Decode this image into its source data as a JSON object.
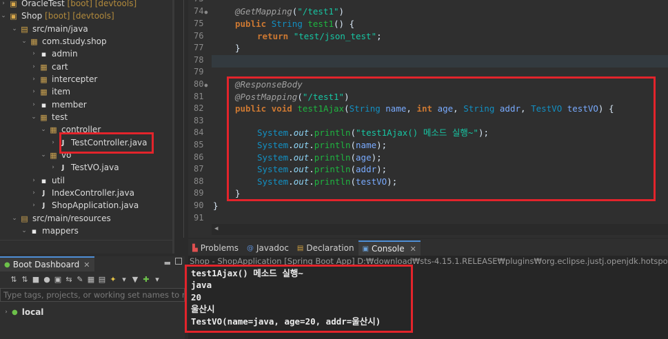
{
  "explorer": {
    "rows": [
      {
        "label": "OracleTest",
        "decor": "[boot] [devtools]"
      },
      {
        "label": "Shop",
        "decor": "[boot] [devtools]"
      },
      {
        "label": "src/main/java"
      },
      {
        "label": "com.study.shop"
      },
      {
        "label": "admin"
      },
      {
        "label": "cart"
      },
      {
        "label": "intercepter"
      },
      {
        "label": "item"
      },
      {
        "label": "member"
      },
      {
        "label": "test"
      },
      {
        "label": "controller"
      },
      {
        "label": "TestController.java"
      },
      {
        "label": "vo"
      },
      {
        "label": "TestVO.java"
      },
      {
        "label": "util"
      },
      {
        "label": "IndexController.java"
      },
      {
        "label": "ShopApplication.java"
      },
      {
        "label": "src/main/resources"
      },
      {
        "label": "mappers"
      }
    ]
  },
  "dashboard": {
    "tab_label": "Boot Dashboard",
    "filter_placeholder": "Type tags, projects, or working set names to match",
    "local_label": "local"
  },
  "editor": {
    "line_numbers": [
      "73",
      "74",
      "75",
      "76",
      "77",
      "78",
      "79",
      "80",
      "81",
      "82",
      "83",
      "84",
      "85",
      "86",
      "87",
      "88",
      "89",
      "90",
      "91"
    ],
    "lines": {
      "l74_ann": "@GetMapping",
      "l74_str": "\"/test1\"",
      "l75_kw": "public",
      "l75_ty": "String",
      "l75_fn": "test1",
      "l76_kw": "return",
      "l76_str": "\"test/json_test\"",
      "l80_ann": "@ResponseBody",
      "l81_ann": "@PostMapping",
      "l81_str": "\"/test1\"",
      "l82_kw1": "public",
      "l82_kw2": "void",
      "l82_fn": "test1Ajax",
      "l82_t1": "String",
      "l82_v1": "name",
      "l82_kw3": "int",
      "l82_v2": "age",
      "l82_t2": "String",
      "l82_v3": "addr",
      "l82_t3": "TestVO",
      "l82_v4": "testVO",
      "sys": "System",
      "out": "out",
      "println": "println",
      "l84_str": "\"test1Ajax() 메소드 실행~\"",
      "l85_v": "name",
      "l86_v": "age",
      "l87_v": "addr",
      "l88_v": "testVO"
    }
  },
  "panel": {
    "tabs": [
      {
        "label": "Problems"
      },
      {
        "label": "Javadoc"
      },
      {
        "label": "Declaration"
      },
      {
        "label": "Console"
      }
    ],
    "console_label": "Shop - ShopApplication [Spring Boot App] D:₩download₩sts-4.15.1.RELEASE₩plugins₩org.eclipse.justj.openjdk.hotspot.jre.full.w",
    "output": [
      "test1Ajax() 메소드 실행~",
      "java",
      "20",
      "울산시",
      "TestVO(name=java, age=20, addr=울산시)"
    ]
  },
  "colors": {
    "highlight": "#e3242b",
    "keyword": "#cc7832",
    "string": "#17c6a3",
    "type": "#1290c3",
    "annotation": "#a0a0a0"
  }
}
